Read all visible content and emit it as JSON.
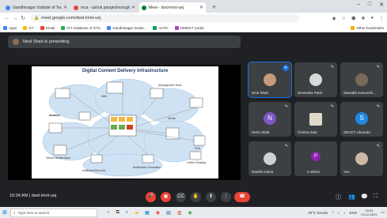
{
  "browser": {
    "tabs": [
      {
        "label": "Gandhinagar Institute of Techno",
        "favicon_color": "#4285f4",
        "active": false
      },
      {
        "label": "mca - ashok parajeshvsingh.s",
        "favicon_color": "#ea4335",
        "active": false
      },
      {
        "label": "Meet - dwd-imnt-uej",
        "favicon_color": "#00832d",
        "active": true
      }
    ],
    "new_tab": "+",
    "window_controls": [
      "–",
      "□",
      "✕"
    ],
    "address": "meet.google.com/dwd-imnt-uej",
    "bookmarks": [
      {
        "label": "Apps",
        "color": "#4285f4"
      },
      {
        "label": "GT",
        "color": "#fbbc04"
      },
      {
        "label": "Gmail",
        "color": "#ea4335"
      },
      {
        "label": "ICT Initiatives of GTU",
        "color": "#34a853"
      },
      {
        "label": "Gandhinagar Institu...",
        "color": "#4285f4"
      },
      {
        "label": "ACPC",
        "color": "#0f9d58"
      },
      {
        "label": "NMEICT portal",
        "color": "#ab47bc"
      }
    ],
    "other_bookmarks": "Other bookmarks"
  },
  "meet": {
    "presenter_banner": "Niral Shah is presenting",
    "slide": {
      "title": "Digital Content Delivery Infrastructure",
      "labels": [
        "Web",
        "Amazon",
        "Virtual infrastructure",
        "Management Tools",
        "Media",
        "PDA",
        "Multimedia / Animation",
        "Online Reading",
        "Institution/School/s"
      ]
    },
    "participants": [
      {
        "name": "Niral Shah",
        "color": "#c79a7a",
        "pinned": true,
        "letter": ""
      },
      {
        "name": "Devendra Patel",
        "color": "#d8d8d8",
        "pinned": false,
        "letter": ""
      },
      {
        "name": "Saurabh Karsonkh...",
        "color": "#7a6a5a",
        "pinned": false,
        "letter": ""
      },
      {
        "name": "Neha Shah",
        "color": "#7e57c2",
        "pinned": false,
        "letter": "N"
      },
      {
        "name": "Chetna Zala",
        "color": "#e0d8c8",
        "pinned": false,
        "letter": ""
      },
      {
        "name": "SDCET Librarian",
        "color": "#1e88e5",
        "pinned": false,
        "letter": "S"
      },
      {
        "name": "Rashik Gamit",
        "color": "#d0d0d0",
        "pinned": false,
        "letter": ""
      },
      {
        "name": "4 others",
        "color": "#8e24aa",
        "pinned": false,
        "letter": "P"
      },
      {
        "name": "You",
        "color": "#cdb8a3",
        "pinned": false,
        "letter": ""
      }
    ],
    "time": "10:34 AM",
    "meeting_code": "dwd-imnt-uej",
    "controls": [
      "mic-off",
      "camera-off",
      "captions",
      "raise-hand",
      "present",
      "more"
    ],
    "end_call": "end"
  },
  "taskbar": {
    "search_placeholder": "Type here to search",
    "weather": "29°C Smoke",
    "lang": "ENG",
    "clock_time": "10:34",
    "clock_date": "23-12-2021"
  }
}
